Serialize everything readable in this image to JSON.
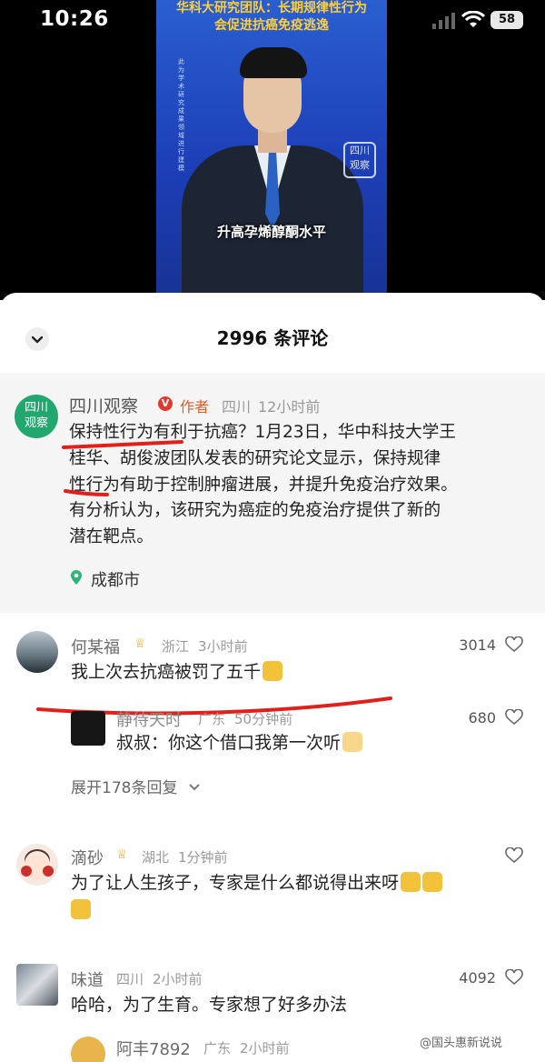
{
  "status_bar": {
    "time": "10:26",
    "battery": "58"
  },
  "video": {
    "headline": [
      "华科大研究团队：长期规律性行为",
      "会促进抗癌免疫逃逸"
    ],
    "side_caption": "此为学术研究成果领域进行建模",
    "station_logo": [
      "四川",
      "观察"
    ],
    "subtitle": "升高孕烯醇酮水平"
  },
  "sheet": {
    "title": "2996 条评论"
  },
  "author_post": {
    "avatar_text": [
      "四川",
      "观察"
    ],
    "name": "四川观察",
    "verified_badge": "V",
    "tag": "作者",
    "region": "四川",
    "time": "12小时前",
    "text_lines": [
      "保持性行为有利于抗癌？1月23日，华中科技大学王",
      "桂华、胡俊波团队发表的研究论文显示，保持规律",
      "性行为有助于控制肿瘤进展，并提升免疫治疗效果。",
      "有分析认为，该研究为癌症的免疫治疗提供了新的",
      "潜在靶点。"
    ],
    "location": "成都市"
  },
  "comments": [
    {
      "name": "何某福",
      "region": "浙江",
      "time": "3小时前",
      "text": "我上次去抗癌被罚了五千",
      "likes": "3014"
    },
    {
      "name": "静待天时",
      "region": "广东",
      "time": "50分钟前",
      "text": "叔叔：你这个借口我第一次听",
      "likes": "680"
    },
    {
      "expand_label": "展开178条回复"
    },
    {
      "name": "滴砂",
      "region": "湖北",
      "time": "1分钟前",
      "text_lines": [
        "为了让人生孩子，专家是什么都说得出来呀",
        ""
      ],
      "likes": ""
    },
    {
      "name": "味道",
      "region": "四川",
      "time": "2小时前",
      "text": "哈哈，为了生育。专家想了好多办法",
      "likes": "4092"
    },
    {
      "name": "阿丰7892",
      "region": "广东",
      "time": "2小时前"
    }
  ],
  "watermark": "@国头惠新说说",
  "colors": {
    "accent_red": "#e0201a",
    "author_tag": "#e05c2a",
    "avatar_green": "#22a86f",
    "crown_gold": "#d4a933"
  },
  "icons": [
    "signal-icon",
    "wifi-icon",
    "battery-icon",
    "chevron-down-icon",
    "verified-icon",
    "location-pin-icon",
    "heart-icon",
    "crown-icon",
    "thumbs-up-icon"
  ]
}
